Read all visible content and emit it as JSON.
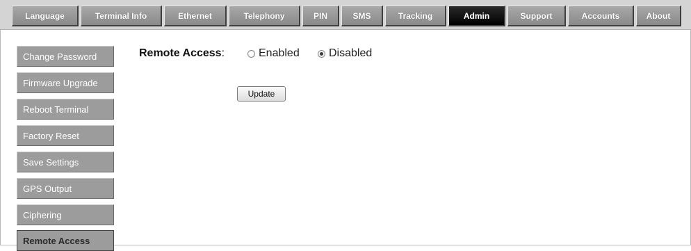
{
  "topnav": {
    "tabs": [
      {
        "label": "Language"
      },
      {
        "label": "Terminal Info"
      },
      {
        "label": "Ethernet"
      },
      {
        "label": "Telephony"
      },
      {
        "label": "PIN"
      },
      {
        "label": "SMS"
      },
      {
        "label": "Tracking"
      },
      {
        "label": "Admin",
        "active": true
      },
      {
        "label": "Support"
      },
      {
        "label": "Accounts"
      },
      {
        "label": "About"
      }
    ]
  },
  "sidebar": {
    "items": [
      {
        "label": "Change Password"
      },
      {
        "label": "Firmware Upgrade"
      },
      {
        "label": "Reboot Terminal"
      },
      {
        "label": "Factory Reset"
      },
      {
        "label": "Save Settings"
      },
      {
        "label": "GPS Output"
      },
      {
        "label": "Ciphering"
      },
      {
        "label": "Remote Access",
        "active": true
      }
    ]
  },
  "main": {
    "field_label": "Remote Access",
    "separator": ":",
    "options": [
      {
        "label": "Enabled",
        "selected": false
      },
      {
        "label": "Disabled",
        "selected": true
      }
    ],
    "update_label": "Update"
  }
}
